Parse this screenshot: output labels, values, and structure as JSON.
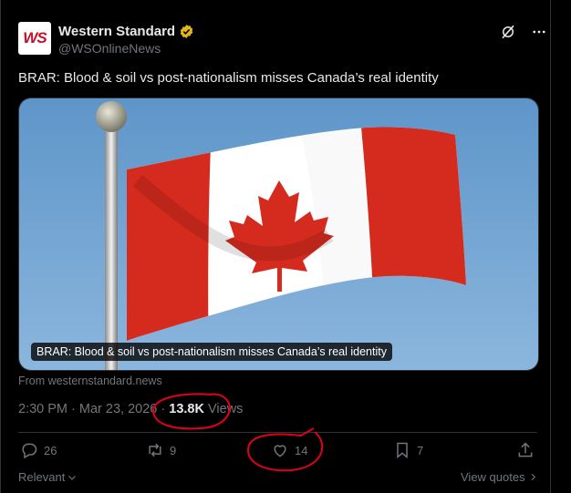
{
  "author": {
    "avatar_text": "WS",
    "name": "Western Standard",
    "handle": "@WSOnlineNews",
    "verified_badge": "gold-check-badge-icon"
  },
  "post": {
    "text": "BRAR: Blood & soil vs post-nationalism misses Canada’s real identity"
  },
  "link_card": {
    "caption": "BRAR: Blood & soil vs post-nationalism misses Canada’s real identity",
    "source": "From westernstandard.news",
    "image": "canadian-flag-on-pole"
  },
  "meta": {
    "time": "2:30 PM",
    "sep1": "·",
    "date": "Mar 23, 2026",
    "sep2": "·",
    "views_count": "13.8K",
    "views_label": "Views"
  },
  "actions": {
    "replies": "26",
    "reposts": "9",
    "likes": "14",
    "bookmarks": "7"
  },
  "footer": {
    "relevant": "Relevant",
    "view_quotes": "View quotes"
  },
  "colors": {
    "background": "#000000",
    "text": "#e7e9ea",
    "muted": "#71767b",
    "annotation": "#e0001a",
    "flag_red": "#d52b1e"
  }
}
